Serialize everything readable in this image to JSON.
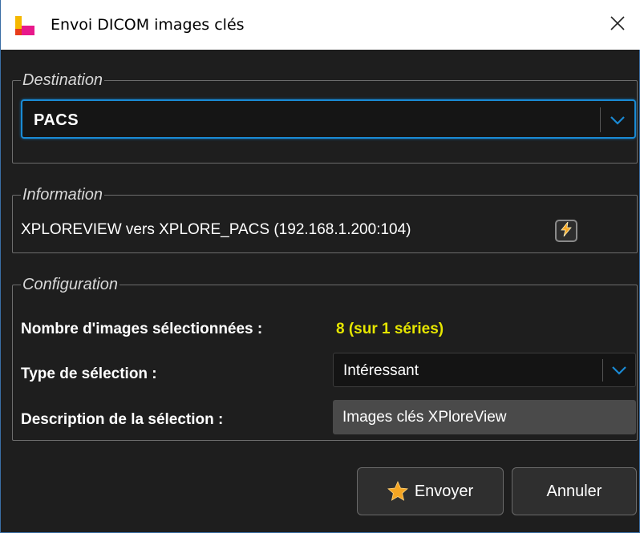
{
  "window": {
    "title": "Envoi DICOM images clés",
    "logo_icon": "app-logo-icon",
    "close_icon": "close-icon"
  },
  "destination": {
    "legend": "Destination",
    "selected": "PACS",
    "arrow_icon": "chevron-down-icon"
  },
  "information": {
    "legend": "Information",
    "text": "XPLOREVIEW vers XPLORE_PACS (192.168.1.200:104)",
    "test_icon": "lightning-icon"
  },
  "configuration": {
    "legend": "Configuration",
    "count_label": "Nombre d'images sélectionnées :",
    "count_value": "8 (sur 1 séries)",
    "type_label": "Type de sélection :",
    "type_value": "Intéressant",
    "desc_label": "Description de la sélection :",
    "desc_value": "Images clés XPloreView"
  },
  "buttons": {
    "send_label": "Envoyer",
    "send_icon": "star-icon",
    "cancel_label": "Annuler"
  },
  "colors": {
    "background": "#1e1e1e",
    "accent_blue": "#1a8ad4",
    "highlight_yellow": "#e6e600",
    "star_orange": "#f5a623"
  }
}
